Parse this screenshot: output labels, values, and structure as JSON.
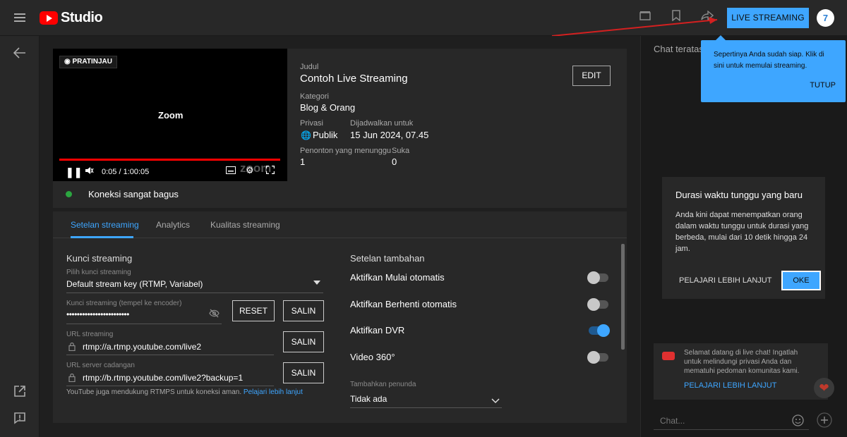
{
  "header": {
    "app_name": "Studio",
    "live_button": "LIVE STREAMING",
    "avatar_initial": "7",
    "icons": [
      "menu-icon",
      "youtube-logo",
      "clapperboard-icon",
      "bookmark-icon",
      "share-icon"
    ]
  },
  "rail": {
    "icons": [
      "back-arrow-icon",
      "external-link-icon",
      "feedback-icon"
    ]
  },
  "preview": {
    "badge": "PRATINJAU",
    "video_text": "Zoom",
    "watermark": "zoom",
    "time": "0:05 / 1:00:05",
    "connection": "Koneksi sangat bagus",
    "title_label": "Judul",
    "title": "Contoh Live Streaming",
    "edit": "EDIT",
    "category_label": "Kategori",
    "category": "Blog & Orang",
    "privacy_label": "Privasi",
    "privacy": "Publik",
    "scheduled_label": "Dijadwalkan untuk",
    "scheduled": "15 Jun 2024, 07.45",
    "waiting_label": "Penonton yang menunggu",
    "waiting": "1",
    "likes_label": "Suka",
    "likes": "0"
  },
  "tabs": [
    {
      "label": "Setelan streaming",
      "active": true
    },
    {
      "label": "Analytics",
      "active": false
    },
    {
      "label": "Kualitas streaming",
      "active": false
    }
  ],
  "stream_key": {
    "title": "Kunci streaming",
    "select_label": "Pilih kunci streaming",
    "select_value": "Default stream key (RTMP, Variabel)",
    "key_label": "Kunci streaming (tempel ke encoder)",
    "key_value": "••••••••••••••••••••••••",
    "reset": "RESET",
    "copy": "SALIN",
    "url_label": "URL streaming",
    "url_value": "rtmp://a.rtmp.youtube.com/live2",
    "backup_label": "URL server cadangan",
    "backup_value": "rtmp://b.rtmp.youtube.com/live2?backup=1",
    "rtmps_note": "YouTube juga mendukung RTMPS untuk koneksi aman.",
    "rtmps_link": "Pelajari lebih lanjut"
  },
  "additional": {
    "title": "Setelan tambahan",
    "options": [
      {
        "label": "Aktifkan Mulai otomatis",
        "on": false
      },
      {
        "label": "Aktifkan Berhenti otomatis",
        "on": false
      },
      {
        "label": "Aktifkan DVR",
        "on": true
      },
      {
        "label": "Video 360°",
        "on": false
      }
    ],
    "delay_label": "Tambahkan penunda",
    "delay_value": "Tidak ada"
  },
  "chat": {
    "header": "Chat teratas",
    "tooltip_text": "Sepertinya Anda sudah siap. Klik di sini untuk memulai streaming.",
    "tooltip_close": "TUTUP",
    "dialog_title": "Durasi waktu tunggu yang baru",
    "dialog_body": "Anda kini dapat menempatkan orang dalam waktu tunggu untuk durasi yang berbeda, mulai dari 10 detik hingga 24 jam.",
    "dialog_learn": "PELAJARI LEBIH LANJUT",
    "dialog_ok": "OKE",
    "welcome_text": "Selamat datang di live chat! Ingatlah untuk melindungi privasi Anda dan mematuhi pedoman komunitas kami.",
    "welcome_link": "PELAJARI LEBIH LANJUT",
    "input_placeholder": "Chat..."
  },
  "colors": {
    "accent": "#3ea6ff",
    "brand_red": "#ff0000",
    "status_green": "#2ba640"
  }
}
